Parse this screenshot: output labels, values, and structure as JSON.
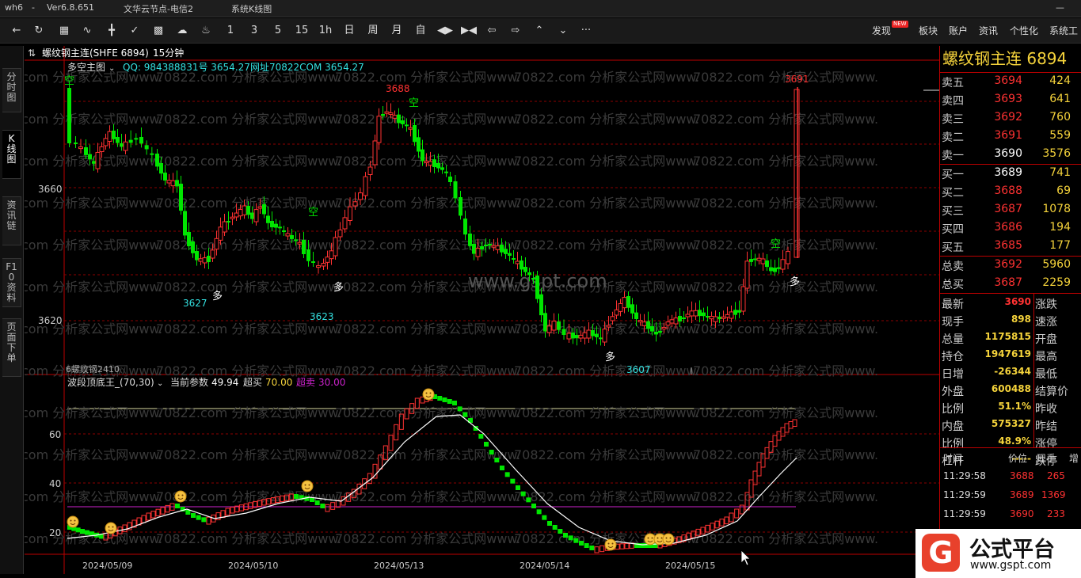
{
  "titlebar": {
    "app": "wh6",
    "dash": "-",
    "version": "Ver6.8.651",
    "server": "文华云节点-电信2",
    "module": "系统K线图"
  },
  "toolbar": {
    "periods": [
      "1",
      "3",
      "5",
      "15",
      "1h",
      "日",
      "周",
      "月",
      "自"
    ],
    "right_menu": [
      "发现",
      "板块",
      "账户",
      "资讯",
      "个性化",
      "系统工"
    ],
    "new_badge": "NEW",
    "more": "···"
  },
  "left_tabs": [
    "分时图",
    "K线图",
    "资讯链",
    "F10资料",
    "页面下单"
  ],
  "chart_header": {
    "symbol": "螺纹钢主连(SHFE 6894)",
    "interval": "15分钟",
    "indicator": "多空主图",
    "qq_text": "QQ: 984388831号 3654.27",
    "url_text": "网址70822COM 3654.27"
  },
  "sub_header": {
    "name": "波段顶底王_(70,30)",
    "param_label": "当前参数",
    "param_value": "49.94",
    "overbuy_label": "超买",
    "overbuy_value": "70.00",
    "oversell_label": "超卖",
    "oversell_value": "30.00"
  },
  "watermarks": {
    "text": "70822.com 分析家公式网www.",
    "center": "www.gspt.com"
  },
  "main_labels": {
    "price_axis": [
      "3660",
      "3620"
    ],
    "marks": [
      {
        "t": "空",
        "k": "short"
      },
      {
        "t": "3688",
        "k": "high"
      },
      {
        "t": "空",
        "k": "short"
      },
      {
        "t": "空",
        "k": "short"
      },
      {
        "t": "3691",
        "k": "high"
      },
      {
        "t": "空",
        "k": "short"
      },
      {
        "t": "3627",
        "k": "low"
      },
      {
        "t": "多",
        "k": "long"
      },
      {
        "t": "3623",
        "k": "low"
      },
      {
        "t": "多",
        "k": "long"
      },
      {
        "t": "多",
        "k": "long"
      },
      {
        "t": "3607",
        "k": "low"
      },
      {
        "t": "多",
        "k": "long"
      }
    ],
    "overlap_text": "6螺纹钢2410"
  },
  "sub_axis": [
    "60",
    "40",
    "20"
  ],
  "dates": [
    "2024/05/09",
    "2024/05/10",
    "2024/05/13",
    "2024/05/14",
    "2024/05/15"
  ],
  "quote": {
    "title": "螺纹钢主连  6894",
    "asks": [
      {
        "label": "卖五",
        "price": "3694",
        "vol": "424"
      },
      {
        "label": "卖四",
        "price": "3693",
        "vol": "641"
      },
      {
        "label": "卖三",
        "price": "3692",
        "vol": "760"
      },
      {
        "label": "卖二",
        "price": "3691",
        "vol": "559"
      },
      {
        "label": "卖一",
        "price": "3690",
        "vol": "3576"
      }
    ],
    "bids": [
      {
        "label": "买一",
        "price": "3689",
        "vol": "741"
      },
      {
        "label": "买二",
        "price": "3688",
        "vol": "69"
      },
      {
        "label": "买三",
        "price": "3687",
        "vol": "1078"
      },
      {
        "label": "买四",
        "price": "3686",
        "vol": "194"
      },
      {
        "label": "买五",
        "price": "3685",
        "vol": "177"
      }
    ],
    "totals": [
      {
        "label": "总卖",
        "price": "3692",
        "vol": "5960"
      },
      {
        "label": "总买",
        "price": "3687",
        "vol": "2259"
      }
    ],
    "stats": [
      {
        "label": "最新",
        "value": "3690",
        "right": "涨跌",
        "color": "red"
      },
      {
        "label": "现手",
        "value": "898",
        "right": "速涨",
        "color": "yel"
      },
      {
        "label": "总量",
        "value": "1175815",
        "right": "开盘",
        "color": "yel"
      },
      {
        "label": "持仓",
        "value": "1947619",
        "right": "最高",
        "color": "yel"
      },
      {
        "label": "日增",
        "value": "-26344",
        "right": "最低",
        "color": "yel"
      },
      {
        "label": "外盘",
        "value": "600488",
        "right": "结算价",
        "color": "yel"
      },
      {
        "label": "比例",
        "value": "51.1%",
        "right": "昨收",
        "color": "yel"
      },
      {
        "label": "内盘",
        "value": "575327",
        "right": "昨结",
        "color": "yel"
      },
      {
        "label": "比例",
        "value": "48.9%",
        "right": "涨停",
        "color": "yel"
      },
      {
        "label": "杠杆",
        "value": "-----",
        "right": "跌停",
        "color": "yel"
      }
    ],
    "ticks_header": [
      "时间",
      "价位",
      "现手",
      "增"
    ],
    "ticks": [
      {
        "time": "11:29:58",
        "price": "3688",
        "vol": "265"
      },
      {
        "time": "11:29:59",
        "price": "3689",
        "vol": "1369"
      },
      {
        "time": "11:29:59",
        "price": "3690",
        "vol": "233"
      }
    ]
  },
  "logo": {
    "mark": "G",
    "name": "公式平台",
    "url": "www.gspt.com"
  },
  "colors": {
    "up": "#ff3232",
    "down": "#00e600",
    "grid": "#8b0000",
    "accent": "#f5d33b"
  }
}
